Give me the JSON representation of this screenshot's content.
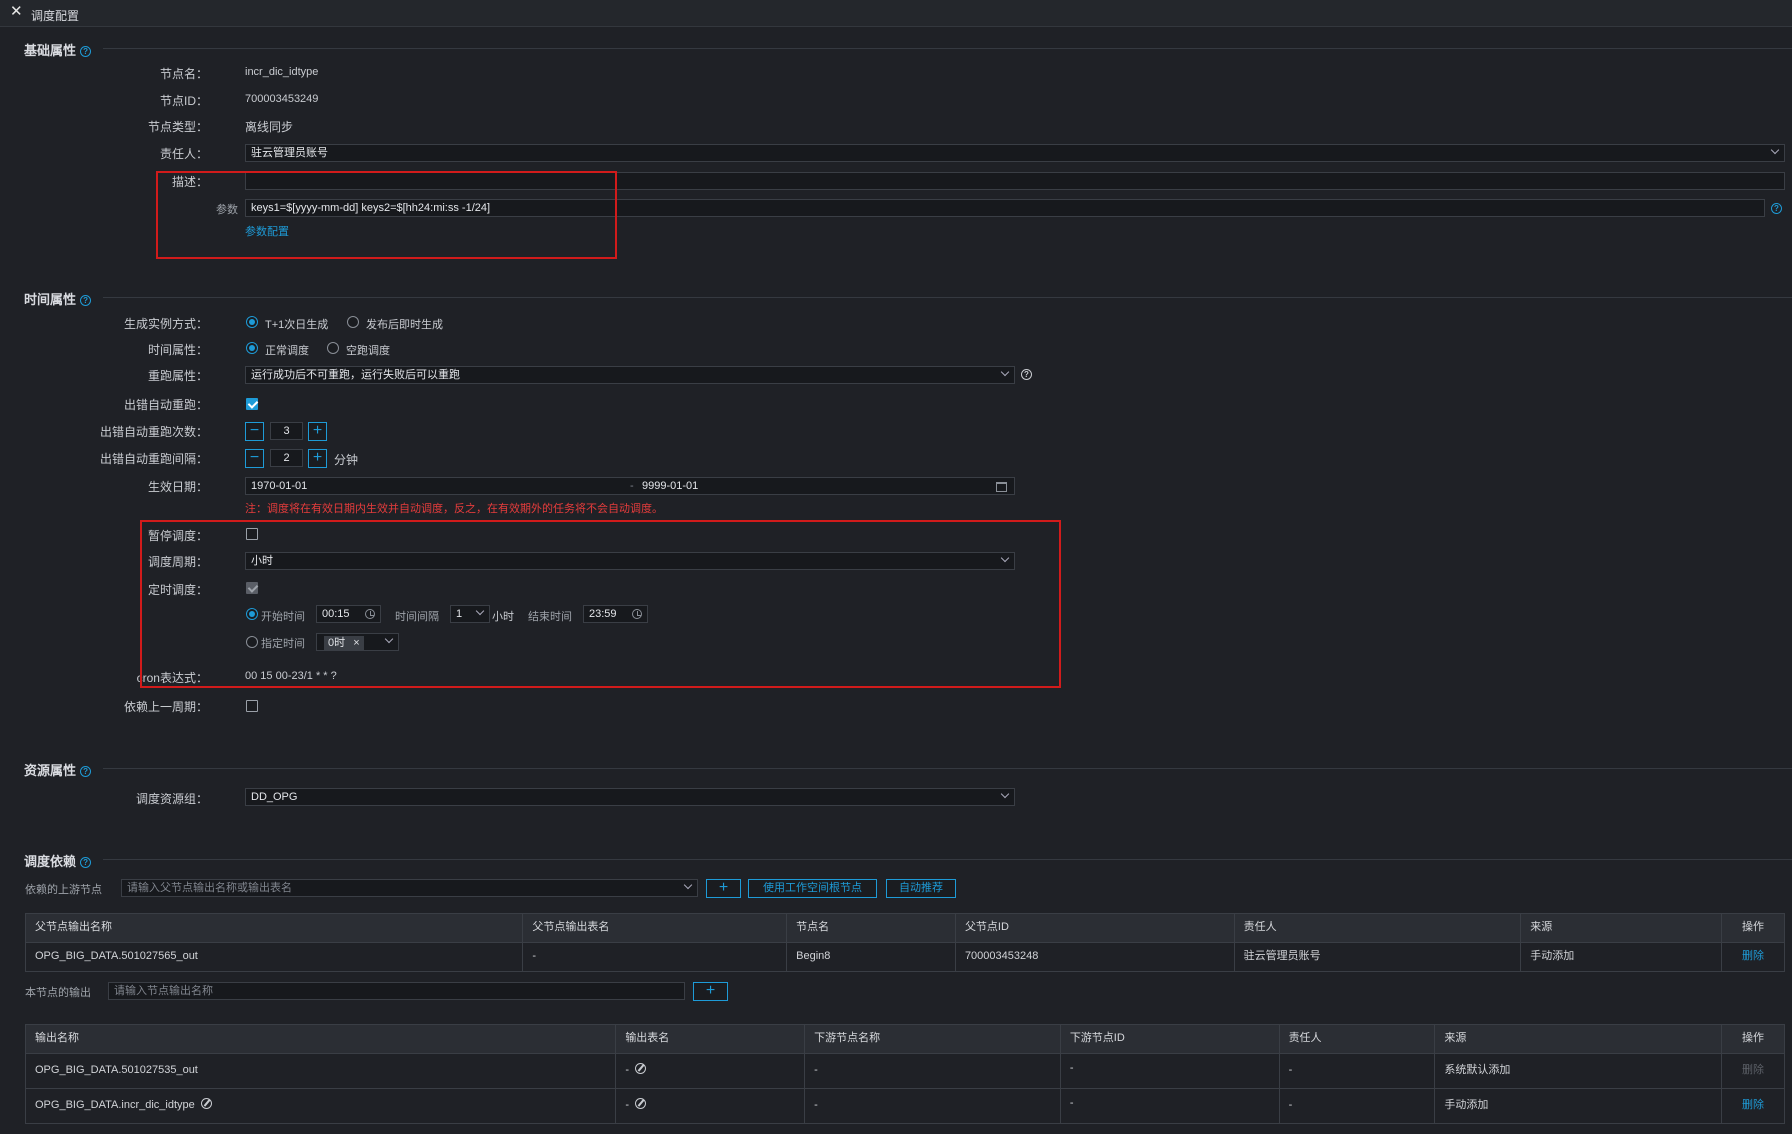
{
  "window": {
    "title": "调度配置"
  },
  "sections": {
    "basic": "基础属性",
    "time": "时间属性",
    "resource": "资源属性",
    "dependency": "调度依赖"
  },
  "basic": {
    "node_name_label": "节点名：",
    "node_name": "incr_dic_idtype",
    "node_id_label": "节点ID：",
    "node_id": "700003453249",
    "node_type_label": "节点类型：",
    "node_type": "离线同步",
    "owner_label": "责任人：",
    "owner": "驻云管理员账号",
    "desc_label": "描述：",
    "desc": "",
    "params_label": "参数",
    "params": "keys1=$[yyyy-mm-dd] keys2=$[hh24:mi:ss -1/24]",
    "params_config_link": "参数配置"
  },
  "time": {
    "gen_mode_label": "生成实例方式：",
    "gen_mode_options": [
      "T+1次日生成",
      "发布后即时生成"
    ],
    "gen_mode_selected": 0,
    "time_attr_label": "时间属性：",
    "time_attr_options": [
      "正常调度",
      "空跑调度"
    ],
    "time_attr_selected": 0,
    "rerun_label": "重跑属性：",
    "rerun_value": "运行成功后不可重跑，运行失败后可以重跑",
    "auto_rerun_label": "出错自动重跑：",
    "auto_rerun_checked": true,
    "rerun_count_label": "出错自动重跑次数：",
    "rerun_count": "3",
    "rerun_interval_label": "出错自动重跑间隔：",
    "rerun_interval": "2",
    "rerun_interval_unit": "分钟",
    "effective_label": "生效日期：",
    "effective_start": "1970-01-01",
    "effective_sep": "-",
    "effective_end": "9999-01-01",
    "effective_note": "注：调度将在有效日期内生效并自动调度，反之，在有效期外的任务将不会自动调度。",
    "pause_label": "暂停调度：",
    "pause_checked": false,
    "cycle_label": "调度周期：",
    "cycle_value": "小时",
    "timed_label": "定时调度：",
    "timed_checked": true,
    "start_time_label": "开始时间",
    "start_time": "00:15",
    "interval_label": "时间间隔",
    "interval_value": "1",
    "interval_unit": "小时",
    "end_time_label": "结束时间",
    "end_time": "23:59",
    "fixed_time_label": "指定时间",
    "fixed_time_tag": "0时",
    "cron_label": "cron表达式：",
    "cron_value": "00 15 00-23/1 * * ?",
    "depend_prev_label": "依赖上一周期：",
    "depend_prev_checked": false
  },
  "resource": {
    "group_label": "调度资源组：",
    "group_value": "DD_OPG"
  },
  "dependency": {
    "upstream_label": "依赖的上游节点",
    "upstream_placeholder": "请输入父节点输出名称或输出表名",
    "add_symbol": "+",
    "use_root_button": "使用工作空间根节点",
    "auto_recommend_button": "自动推荐",
    "upstream_columns": [
      "父节点输出名称",
      "父节点输出表名",
      "节点名",
      "父节点ID",
      "责任人",
      "来源",
      "操作"
    ],
    "upstream_rows": [
      {
        "output_name": "OPG_BIG_DATA.501027565_out",
        "output_table": "-",
        "node_name": "Begin8",
        "parent_id": "700003453248",
        "owner": "驻云管理员账号",
        "source": "手动添加",
        "action": "删除"
      }
    ],
    "output_label": "本节点的输出",
    "output_placeholder": "请输入节点输出名称",
    "output_columns": [
      "输出名称",
      "输出表名",
      "下游节点名称",
      "下游节点ID",
      "责任人",
      "来源",
      "操作"
    ],
    "output_rows": [
      {
        "output_name": "OPG_BIG_DATA.501027535_out",
        "output_table": "-",
        "downstream_name": "-",
        "downstream_id": "-",
        "owner": "-",
        "source": "系统默认添加",
        "action": "删除"
      },
      {
        "output_name": "OPG_BIG_DATA.incr_dic_idtype",
        "output_table": "-",
        "downstream_name": "-",
        "downstream_id": "-",
        "owner": "-",
        "source": "手动添加",
        "action": "删除"
      }
    ]
  },
  "colors": {
    "accent": "#1e9bd7",
    "highlight_box": "#d11b1b",
    "warning_text": "#e53c3c",
    "background": "#1f2126"
  }
}
